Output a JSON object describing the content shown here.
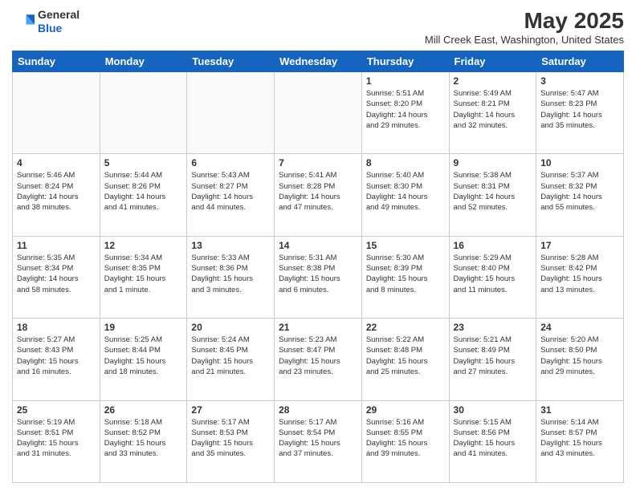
{
  "header": {
    "logo_line1": "General",
    "logo_line2": "Blue",
    "month_year": "May 2025",
    "location": "Mill Creek East, Washington, United States"
  },
  "days_of_week": [
    "Sunday",
    "Monday",
    "Tuesday",
    "Wednesday",
    "Thursday",
    "Friday",
    "Saturday"
  ],
  "weeks": [
    [
      {
        "day": "",
        "info": ""
      },
      {
        "day": "",
        "info": ""
      },
      {
        "day": "",
        "info": ""
      },
      {
        "day": "",
        "info": ""
      },
      {
        "day": "1",
        "info": "Sunrise: 5:51 AM\nSunset: 8:20 PM\nDaylight: 14 hours\nand 29 minutes."
      },
      {
        "day": "2",
        "info": "Sunrise: 5:49 AM\nSunset: 8:21 PM\nDaylight: 14 hours\nand 32 minutes."
      },
      {
        "day": "3",
        "info": "Sunrise: 5:47 AM\nSunset: 8:23 PM\nDaylight: 14 hours\nand 35 minutes."
      }
    ],
    [
      {
        "day": "4",
        "info": "Sunrise: 5:46 AM\nSunset: 8:24 PM\nDaylight: 14 hours\nand 38 minutes."
      },
      {
        "day": "5",
        "info": "Sunrise: 5:44 AM\nSunset: 8:26 PM\nDaylight: 14 hours\nand 41 minutes."
      },
      {
        "day": "6",
        "info": "Sunrise: 5:43 AM\nSunset: 8:27 PM\nDaylight: 14 hours\nand 44 minutes."
      },
      {
        "day": "7",
        "info": "Sunrise: 5:41 AM\nSunset: 8:28 PM\nDaylight: 14 hours\nand 47 minutes."
      },
      {
        "day": "8",
        "info": "Sunrise: 5:40 AM\nSunset: 8:30 PM\nDaylight: 14 hours\nand 49 minutes."
      },
      {
        "day": "9",
        "info": "Sunrise: 5:38 AM\nSunset: 8:31 PM\nDaylight: 14 hours\nand 52 minutes."
      },
      {
        "day": "10",
        "info": "Sunrise: 5:37 AM\nSunset: 8:32 PM\nDaylight: 14 hours\nand 55 minutes."
      }
    ],
    [
      {
        "day": "11",
        "info": "Sunrise: 5:35 AM\nSunset: 8:34 PM\nDaylight: 14 hours\nand 58 minutes."
      },
      {
        "day": "12",
        "info": "Sunrise: 5:34 AM\nSunset: 8:35 PM\nDaylight: 15 hours\nand 1 minute."
      },
      {
        "day": "13",
        "info": "Sunrise: 5:33 AM\nSunset: 8:36 PM\nDaylight: 15 hours\nand 3 minutes."
      },
      {
        "day": "14",
        "info": "Sunrise: 5:31 AM\nSunset: 8:38 PM\nDaylight: 15 hours\nand 6 minutes."
      },
      {
        "day": "15",
        "info": "Sunrise: 5:30 AM\nSunset: 8:39 PM\nDaylight: 15 hours\nand 8 minutes."
      },
      {
        "day": "16",
        "info": "Sunrise: 5:29 AM\nSunset: 8:40 PM\nDaylight: 15 hours\nand 11 minutes."
      },
      {
        "day": "17",
        "info": "Sunrise: 5:28 AM\nSunset: 8:42 PM\nDaylight: 15 hours\nand 13 minutes."
      }
    ],
    [
      {
        "day": "18",
        "info": "Sunrise: 5:27 AM\nSunset: 8:43 PM\nDaylight: 15 hours\nand 16 minutes."
      },
      {
        "day": "19",
        "info": "Sunrise: 5:25 AM\nSunset: 8:44 PM\nDaylight: 15 hours\nand 18 minutes."
      },
      {
        "day": "20",
        "info": "Sunrise: 5:24 AM\nSunset: 8:45 PM\nDaylight: 15 hours\nand 21 minutes."
      },
      {
        "day": "21",
        "info": "Sunrise: 5:23 AM\nSunset: 8:47 PM\nDaylight: 15 hours\nand 23 minutes."
      },
      {
        "day": "22",
        "info": "Sunrise: 5:22 AM\nSunset: 8:48 PM\nDaylight: 15 hours\nand 25 minutes."
      },
      {
        "day": "23",
        "info": "Sunrise: 5:21 AM\nSunset: 8:49 PM\nDaylight: 15 hours\nand 27 minutes."
      },
      {
        "day": "24",
        "info": "Sunrise: 5:20 AM\nSunset: 8:50 PM\nDaylight: 15 hours\nand 29 minutes."
      }
    ],
    [
      {
        "day": "25",
        "info": "Sunrise: 5:19 AM\nSunset: 8:51 PM\nDaylight: 15 hours\nand 31 minutes."
      },
      {
        "day": "26",
        "info": "Sunrise: 5:18 AM\nSunset: 8:52 PM\nDaylight: 15 hours\nand 33 minutes."
      },
      {
        "day": "27",
        "info": "Sunrise: 5:17 AM\nSunset: 8:53 PM\nDaylight: 15 hours\nand 35 minutes."
      },
      {
        "day": "28",
        "info": "Sunrise: 5:17 AM\nSunset: 8:54 PM\nDaylight: 15 hours\nand 37 minutes."
      },
      {
        "day": "29",
        "info": "Sunrise: 5:16 AM\nSunset: 8:55 PM\nDaylight: 15 hours\nand 39 minutes."
      },
      {
        "day": "30",
        "info": "Sunrise: 5:15 AM\nSunset: 8:56 PM\nDaylight: 15 hours\nand 41 minutes."
      },
      {
        "day": "31",
        "info": "Sunrise: 5:14 AM\nSunset: 8:57 PM\nDaylight: 15 hours\nand 43 minutes."
      }
    ]
  ]
}
